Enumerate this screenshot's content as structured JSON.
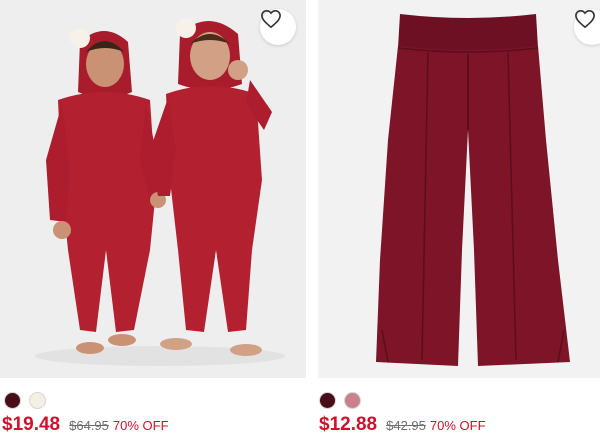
{
  "products": [
    {
      "image_alt": "",
      "favorite_icon": "heart-outline-icon",
      "swatches": [
        {
          "color": "#4a0c17"
        },
        {
          "color": "#f4f1e4"
        }
      ],
      "sale_price": "$19.48",
      "original_price": "$64.95",
      "discount": "70% OFF"
    },
    {
      "image_alt": "",
      "favorite_icon": "heart-outline-icon",
      "swatches": [
        {
          "color": "#4a0c17"
        },
        {
          "color": "#c9828a"
        }
      ],
      "sale_price": "$12.88",
      "original_price": "$42.95",
      "discount": "70% OFF"
    }
  ],
  "colors": {
    "sale_red": "#d0112b",
    "onesie_red": "#b3202f",
    "pants_burgundy": "#7d1428"
  }
}
